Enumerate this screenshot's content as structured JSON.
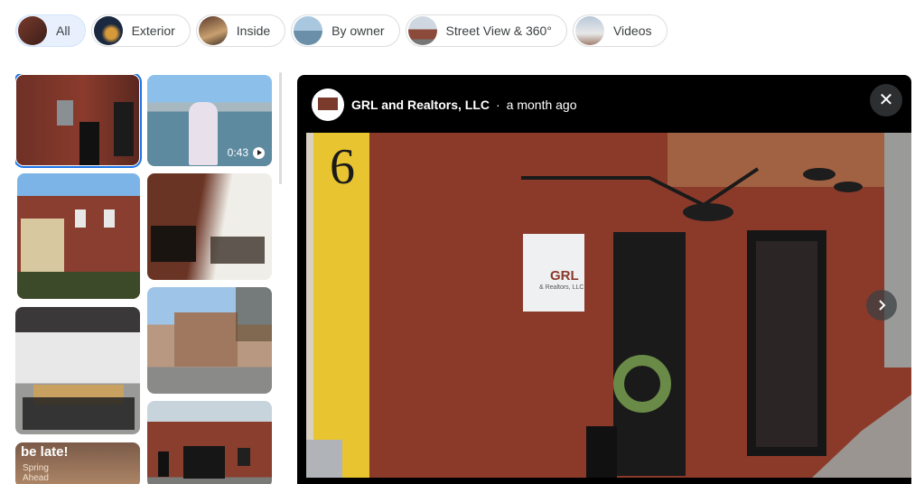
{
  "filters": [
    {
      "label": "All",
      "active": true
    },
    {
      "label": "Exterior",
      "active": false
    },
    {
      "label": "Inside",
      "active": false
    },
    {
      "label": "By owner",
      "active": false
    },
    {
      "label": "Street View & 360°",
      "active": false
    },
    {
      "label": "Videos",
      "active": false
    }
  ],
  "thumbnails": {
    "video_duration": "0:43",
    "poster_text_1": "be late!",
    "poster_text_2": "Spring",
    "poster_text_3": "Ahead"
  },
  "viewer": {
    "owner": "GRL and Realtors, LLC",
    "separator": "·",
    "time_ago": "a month ago",
    "close_glyph": "✕",
    "building_number": "6",
    "sign_text": "GRL",
    "sign_subtext": "& Realtors, LLC"
  },
  "colors": {
    "accent": "#1a73e8",
    "chip_active_bg": "#e8f0fe",
    "viewer_bg": "#000000",
    "brick": "#8b3a2a"
  }
}
